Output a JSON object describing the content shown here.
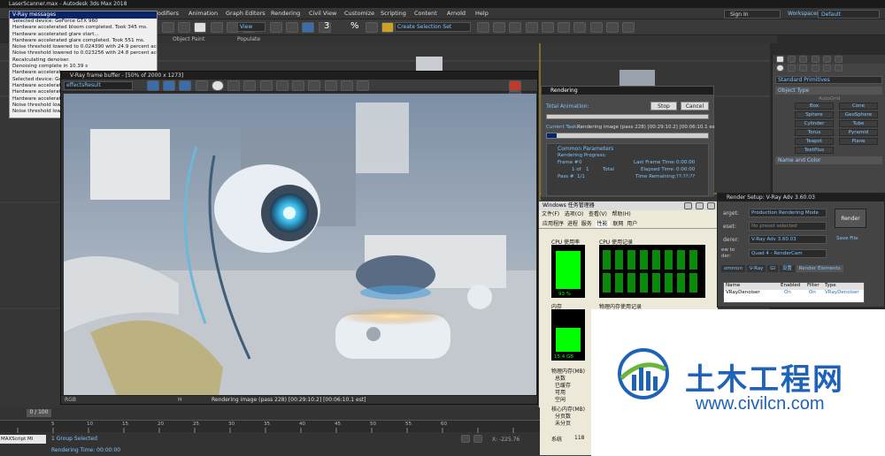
{
  "app": {
    "title": "LaserScanner.max - Autodesk 3ds Max 2018",
    "menu": [
      "odifiers",
      "Animation",
      "Graph Editors",
      "Rendering",
      "Civil View",
      "Customize",
      "Scripting",
      "Content",
      "Arnold",
      "Help"
    ],
    "sign_in": "Sign In",
    "workspaces_label": "Workspaces:",
    "workspace_value": "Default",
    "view_dropdown": "View",
    "create_selection_set": "Create Selection Set",
    "toolbar_numbers": [
      "3",
      "%"
    ],
    "sub_labels": [
      "Object Paint",
      "Populate"
    ]
  },
  "vray_messages": {
    "title": "V-Ray messages",
    "lines": [
      "Selected device: GeForce GTX 960",
      "Hardware accelerated bloom completed. Took 345 ms.",
      "Hardware accelerated glare start...",
      "Hardware accelerated glare completed. Took 551 ms.",
      "Noise threshold lowered to 0.024390 with 24.9 percent active",
      "Noise threshold lowered to 0.023256 with 24.8 percent active",
      "Recalculating denoiser.",
      "Denoising complete in 10.39 s",
      "Hardware accelerat",
      "Selected device: GeF",
      "Hardware accelerat",
      "Hardware accelerat",
      "Hardware accelerat",
      "Noise threshold lowere",
      "Noise threshold lowere"
    ]
  },
  "frame_buffer": {
    "title": "V-Ray frame buffer - [50% of 2000 x 1273]",
    "channel": "effectsResult",
    "status": "Rendering image (pass 228) [00:29:10.2] [00:06:10.1 est]",
    "channel_labels": [
      "RGB",
      "H"
    ]
  },
  "rendering": {
    "title": "Rendering",
    "total_animation": "Total Animation:",
    "stop": "Stop",
    "cancel": "Cancel",
    "current_task_label": "Current Task:",
    "current_task": "Rendering image (pass 228) [00:29:10.2] [00:06:10.1 es",
    "common_parameters": "Common Parameters",
    "rendering_progress": "Rendering Progress:",
    "frame_label": "Frame #",
    "frame_value": "0",
    "of_label": "1 of",
    "of_value": "1",
    "total_label": "Total",
    "pass_label": "Pass #",
    "pass_value": "1/1",
    "last_frame_time_label": "Last Frame Time:",
    "last_frame_time": "0:00:00",
    "elapsed_label": "Elapsed Time:",
    "elapsed": "0:00:00",
    "remaining_label": "Time Remaining:",
    "remaining": "??:??:??"
  },
  "task_manager": {
    "title": "Windows 任务管理器",
    "menu": [
      "文件(F)",
      "选项(O)",
      "查看(V)",
      "帮助(H)"
    ],
    "tabs": [
      "应用程序",
      "进程",
      "服务",
      "性能",
      "联网",
      "用户"
    ],
    "cpu_usage_label": "CPU 使用率",
    "cpu_usage_value": "93 %",
    "cpu_history_label": "CPU 使用记录",
    "mem_label": "内存",
    "mem_value": "15.4 GB",
    "mem_history_label": "物理内存使用记录",
    "phys_mem_label": "物理内存(MB)",
    "phys_rows": [
      "总数",
      "已缓存",
      "可用",
      "空闲"
    ],
    "kernel_label": "核心内存(MB)",
    "kernel_rows": [
      "分页数",
      "未分页"
    ],
    "system_label": "系统",
    "system_value": "118",
    "cpu_percent": 0.93,
    "mem_fraction": 0.62
  },
  "command_panel": {
    "dropdown": "Standard Primitives",
    "object_type": "Object Type",
    "autogrid": "AutoGrid",
    "buttons": [
      "Box",
      "Cone",
      "Sphere",
      "GeoSphere",
      "Cylinder",
      "Tube",
      "Torus",
      "Pyramid",
      "Teapot",
      "Plane",
      "TextPlus"
    ],
    "name_and_color": "Name and Color"
  },
  "render_setup": {
    "title": "Render Setup: V-Ray Adv 3.60.03",
    "target_label": "arget:",
    "target_value": "Production Rendering Mode",
    "preset_label": "eset:",
    "preset_value": "No preset selected",
    "renderer_label": "derer:",
    "renderer_value": "V-Ray Adv 3.60.03",
    "save_file": "Save File",
    "render_button": "Render",
    "view_label": "ew to\nder:",
    "view_value": "Quad 4 - RenderCam",
    "tabs": [
      "ommon",
      "V-Ray",
      "GI",
      "设置",
      "Render Elements"
    ],
    "table_headers": [
      "Name",
      "Enabled",
      "Filter",
      "Type"
    ],
    "table_row": [
      "VRayDenoiser",
      "On",
      "On",
      "VRayDenoiser"
    ]
  },
  "timeline": {
    "frame_counter": "0 / 100",
    "ticks": [
      "5",
      "10",
      "15",
      "20",
      "25",
      "30",
      "35",
      "40",
      "45",
      "50",
      "55",
      "60"
    ],
    "status_left": "1 Group Selected",
    "status_bottom": "Rendering Time: 00:00:00",
    "maxscript": "MAXScript Mi",
    "x_readout": "X: -225.76"
  },
  "watermark": {
    "brand": "土木工程网",
    "url": "www.civilcn.com",
    "colors": {
      "blue": "#1e63b8",
      "green": "#6db43b"
    }
  }
}
